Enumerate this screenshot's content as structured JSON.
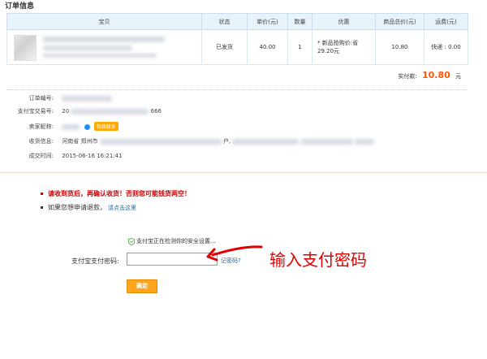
{
  "section_title": "订单信息",
  "table": {
    "headers": [
      "宝贝",
      "状态",
      "单价(元)",
      "数量",
      "优惠",
      "商品总价(元)",
      "运费(元)"
    ],
    "row": {
      "status": "已发货",
      "unit_price": "40.00",
      "quantity": "1",
      "promo_line1": "* 新品抢购价:省",
      "promo_line2": "29.20元",
      "total": "10.80",
      "shipping": "快递 : 0.00"
    }
  },
  "paid": {
    "label": "实付款:",
    "amount": "10.80",
    "unit": "元"
  },
  "info": {
    "order_no_label": "订单编号:",
    "alipay_no_label": "支付宝交易号:",
    "alipay_no_prefix": "20",
    "alipay_no_suffix": "666",
    "seller_label": "卖家昵称:",
    "contact_label": "和我联系",
    "address_label": "收货信息:",
    "address_province": "河南省",
    "address_city": "郑州市",
    "address_mid": "户,",
    "deal_time_label": "成交时间:",
    "deal_time": "2015-06-16 16:21:41"
  },
  "warning": "请收到货后，再确认收货！否则您可能钱货两空！",
  "refund": {
    "text": "如果您想申请退款，",
    "link": "请点击这里"
  },
  "security_text": "支付宝正在检测你的安全设置...",
  "password": {
    "label": "支付宝支付密码:",
    "value": "",
    "forgot": "记密码?"
  },
  "confirm_label": "确定",
  "annotation": "输入支付密码",
  "colors": {
    "accent": "#ff5500",
    "warning": "#cc0000",
    "button": "#ffa51f",
    "annotation": "#e00000"
  }
}
